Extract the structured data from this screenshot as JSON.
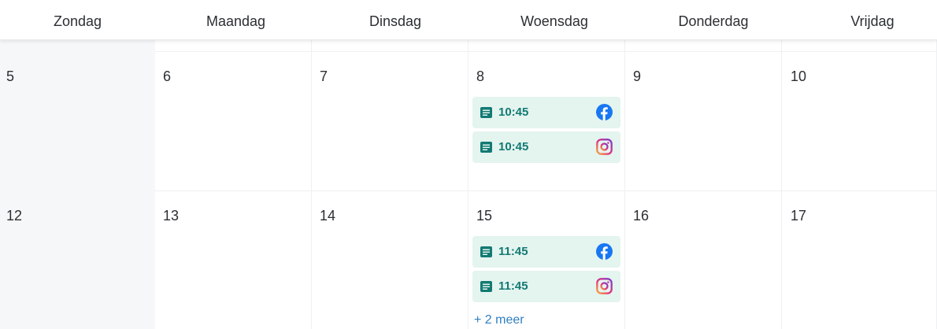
{
  "weekdays": [
    "Zondag",
    "Maandag",
    "Dinsdag",
    "Woensdag",
    "Donderdag",
    "Vrijdag"
  ],
  "weeks": [
    {
      "days": [
        "5",
        "6",
        "7",
        "8",
        "9",
        "10"
      ],
      "events": [
        {
          "day": "8",
          "time": "10:45",
          "network": "facebook-icon"
        },
        {
          "day": "8",
          "time": "10:45",
          "network": "instagram-icon"
        }
      ]
    },
    {
      "days": [
        "12",
        "13",
        "14",
        "15",
        "16",
        "17"
      ],
      "events": [
        {
          "day": "15",
          "time": "11:45",
          "network": "facebook-icon"
        },
        {
          "day": "15",
          "time": "11:45",
          "network": "instagram-icon"
        }
      ],
      "more_label": "+ 2 meer"
    }
  ],
  "colors": {
    "event_bg": "#e4f4ef",
    "event_text": "#127a73",
    "sunday_bg": "#f5f7f9",
    "link": "#2f7fc1",
    "facebook": "#1877f2"
  }
}
